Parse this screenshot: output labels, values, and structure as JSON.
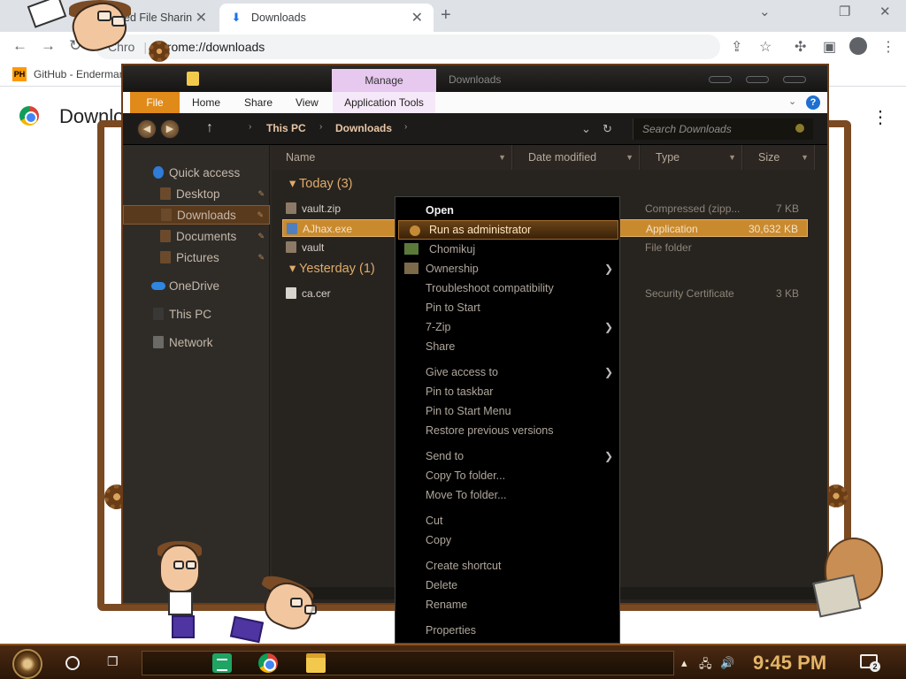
{
  "browser": {
    "tab_inactive_title": "ed File Sharin",
    "tab_active_title": "Downloads",
    "omnibox_chip": "Chro",
    "omnibox_url": "chrome://downloads",
    "bookmark_icon_text": "PH",
    "bookmark_label": "GitHub - Enderman",
    "page_title": "Downloads"
  },
  "explorer": {
    "title_tab": "Manage",
    "title_label": "Downloads",
    "ribbon_tabs": {
      "file": "File",
      "home": "Home",
      "share": "Share",
      "view": "View",
      "app_tools": "Application Tools"
    },
    "help_glyph": "?",
    "breadcrumb": [
      "This PC",
      "Downloads"
    ],
    "search_placeholder": "Search Downloads",
    "nav": {
      "quick_access": "Quick access",
      "desktop": "Desktop",
      "downloads": "Downloads",
      "documents": "Documents",
      "pictures": "Pictures",
      "onedrive": "OneDrive",
      "this_pc": "This PC",
      "network": "Network"
    },
    "columns": {
      "name": "Name",
      "date_modified": "Date modified",
      "type": "Type",
      "size": "Size"
    },
    "groups": {
      "today": "Today (3)",
      "yesterday": "Yesterday (1)"
    },
    "files": [
      {
        "name": "vault.zip",
        "type": "Compressed (zipp...",
        "size": "7 KB"
      },
      {
        "name": "AJhax.exe",
        "type": "Application",
        "size": "30,632 KB"
      },
      {
        "name": "vault",
        "type": "File folder",
        "size": ""
      },
      {
        "name": "ca.cer",
        "type": "Security Certificate",
        "size": "3 KB"
      }
    ]
  },
  "context_menu": {
    "open": "Open",
    "run_as_admin": "Run as administrator",
    "chomikuj": "Chomikuj",
    "ownership": "Ownership",
    "troubleshoot": "Troubleshoot compatibility",
    "pin_to_start": "Pin to Start",
    "seven_zip": "7-Zip",
    "share": "Share",
    "give_access": "Give access to",
    "pin_to_taskbar": "Pin to taskbar",
    "pin_to_start_menu": "Pin to Start Menu",
    "restore_versions": "Restore previous versions",
    "send_to": "Send to",
    "copy_to_folder": "Copy To folder...",
    "move_to_folder": "Move To folder...",
    "cut": "Cut",
    "copy": "Copy",
    "create_shortcut": "Create shortcut",
    "delete": "Delete",
    "rename": "Rename",
    "properties": "Properties"
  },
  "taskbar": {
    "clock": "9:45 PM",
    "notification_count": "2"
  }
}
